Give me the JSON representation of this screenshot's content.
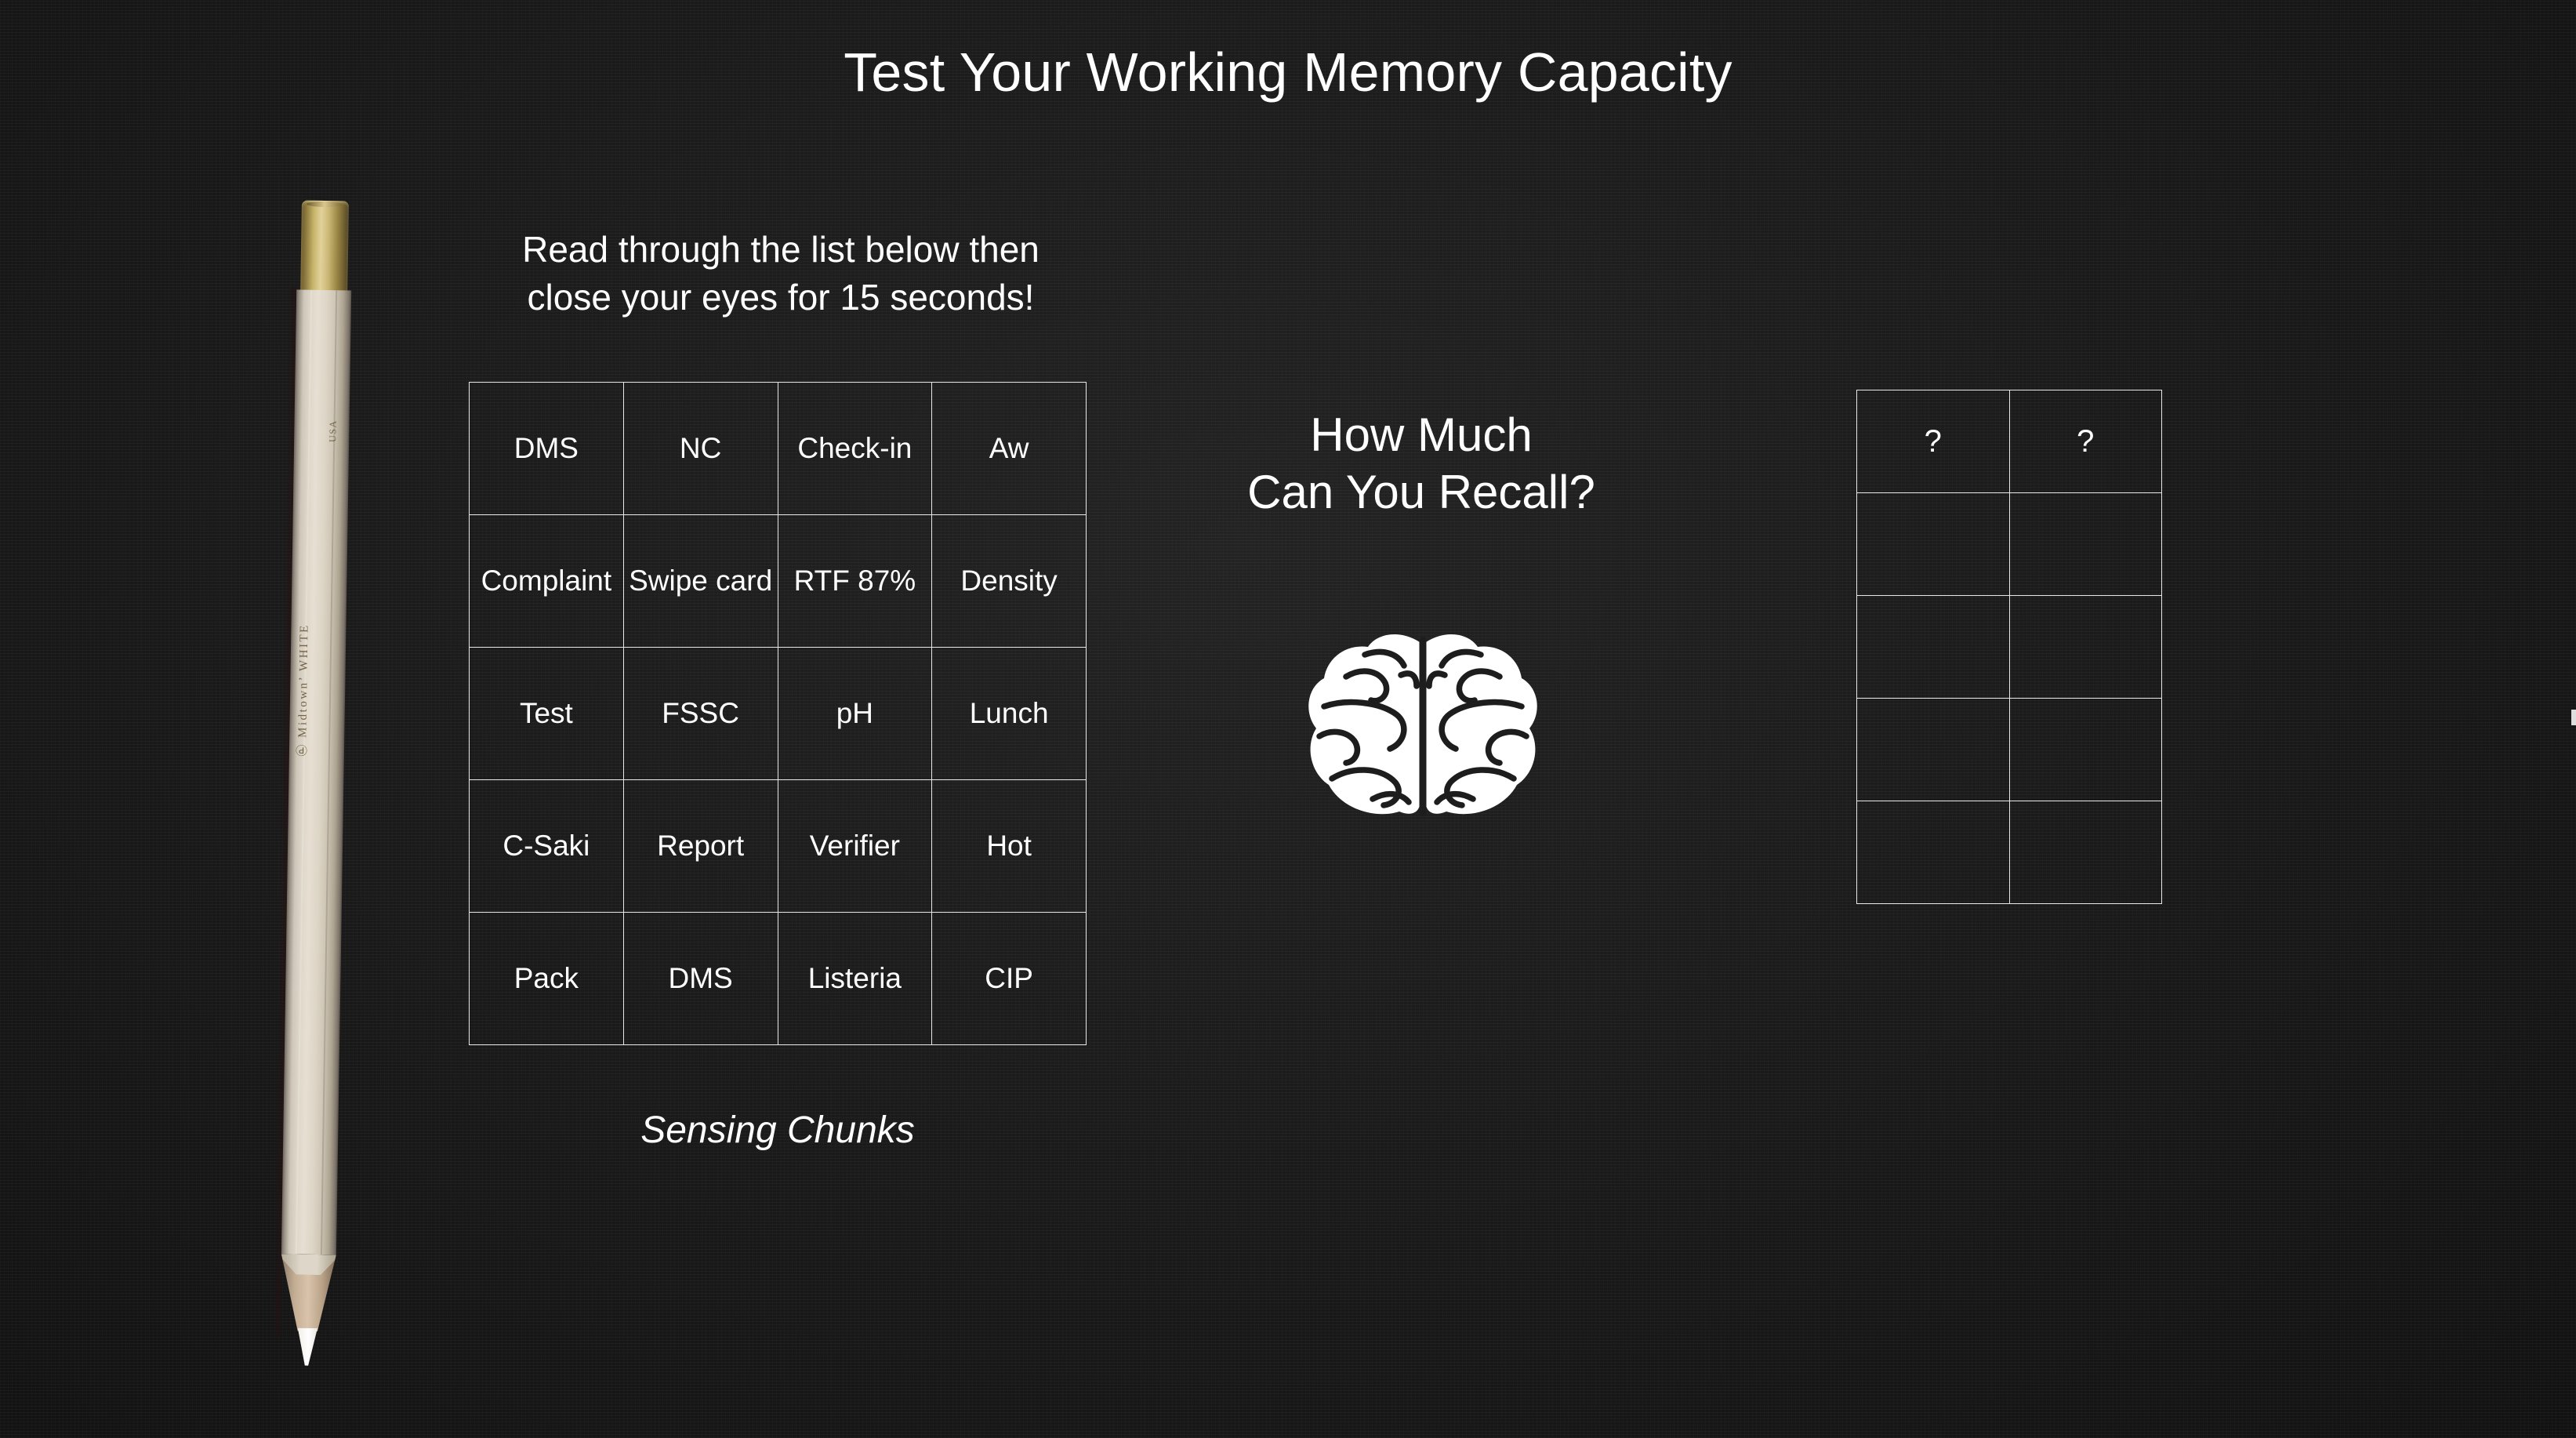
{
  "slide": {
    "title": "Test Your Working Memory Capacity",
    "background_color": "#191919",
    "text_color": "#ffffff"
  },
  "instructions": {
    "line1": "Read through the list below then",
    "line2": "close your eyes for 15 seconds!"
  },
  "stimulus_table": {
    "caption": "Sensing Chunks",
    "rows": [
      [
        "DMS",
        "NC",
        "Check-in",
        "Aw"
      ],
      [
        "Complaint",
        "Swipe card",
        "RTF 87%",
        "Density"
      ],
      [
        "Test",
        "FSSC",
        "pH",
        "Lunch"
      ],
      [
        "C-Saki",
        "Report",
        "Verifier",
        "Hot"
      ],
      [
        "Pack",
        "DMS",
        "Listeria",
        "CIP"
      ]
    ]
  },
  "recall_prompt": {
    "line1": "How Much",
    "line2": "Can You Recall?",
    "icon": "brain-icon"
  },
  "answer_table": {
    "rows": [
      [
        "?",
        "?"
      ],
      [
        "",
        ""
      ],
      [
        "",
        ""
      ],
      [
        "",
        ""
      ],
      [
        "",
        ""
      ]
    ]
  },
  "pencil": {
    "brand_imprint": "Ⓟ Midtown’ WHITE",
    "origin_imprint": "USA"
  }
}
